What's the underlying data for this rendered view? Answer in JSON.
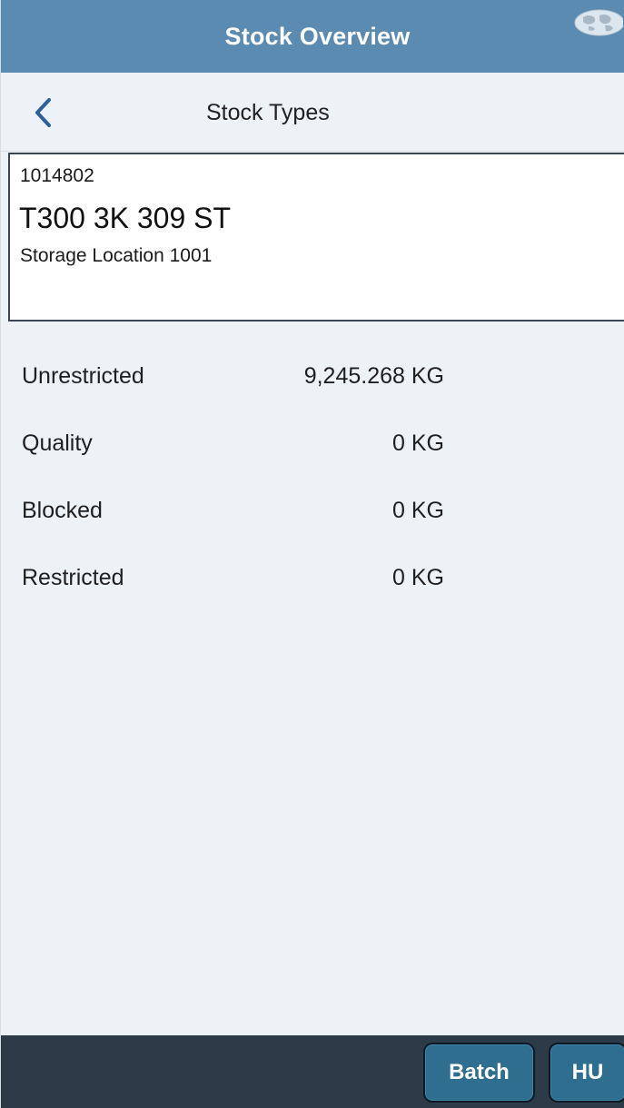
{
  "header": {
    "title": "Stock Overview",
    "globe_icon": "globe-icon"
  },
  "subheader": {
    "back_icon": "chevron-left-icon",
    "title": "Stock Types"
  },
  "material": {
    "number": "1014802",
    "description": "T300 3K 309 ST",
    "storage_location": "Storage Location 1001"
  },
  "stock_types": [
    {
      "label": "Unrestricted",
      "value": "9,245.268 KG"
    },
    {
      "label": "Quality",
      "value": "0 KG"
    },
    {
      "label": "Blocked",
      "value": "0 KG"
    },
    {
      "label": "Restricted",
      "value": "0 KG"
    }
  ],
  "footer": {
    "batch_label": "Batch",
    "hu_label": "HU"
  },
  "colors": {
    "header_bg": "#5b8bb0",
    "footer_bg": "#2d3a48",
    "button_bg": "#2f6e8f",
    "back_icon": "#2b5f9e"
  }
}
